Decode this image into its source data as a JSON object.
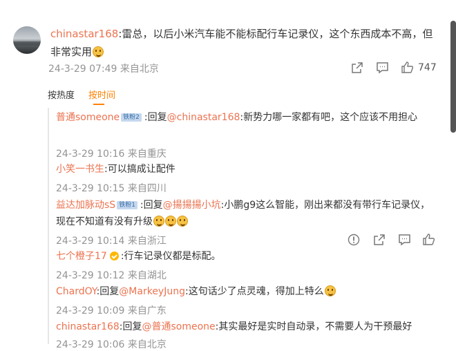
{
  "comment": {
    "author": "chinastar168",
    "text": ":雷总，以后小米汽车能不能标配行车记录仪，这个东西成本不高，但非常实用",
    "time_loc": "24-3-29 07:49 来自北京",
    "like_count": "747"
  },
  "sort": {
    "by_hot": "按热度",
    "by_time": "按时间"
  },
  "replies": [
    {
      "author": "普通someone",
      "badge": "铁粉2",
      "reply_word": ":回复",
      "mention": "@chinastar168",
      "text": ":新势力哪一家都有吧，这个应该不用担心",
      "time_loc": "24-3-29 10:16 来自重庆"
    },
    {
      "author": "小笑一书生",
      "text": ":可以搞成让配件",
      "time_loc": "24-3-29 10:15 来自四川"
    },
    {
      "author": "益达加脉动sS",
      "badge": "铁粉1",
      "reply_word": ":回复",
      "mention": "@揚揚揚小坑",
      "text": ":小鹏g9这么智能，刚出来都没有带行车记录仪，现在不知道有没有升级",
      "time_loc": "24-3-29 10:14 来自浙江"
    },
    {
      "author": "七个橙子17",
      "text": ":行车记录仪都是标配。",
      "time_loc": "24-3-29 10:12 来自湖北"
    },
    {
      "author": "ChardOY",
      "reply_word": ":回复",
      "mention": "@MarkeyJung",
      "text": ":这句话少了点灵魂，得加上特么",
      "time_loc": "24-3-29 10:09 来自广东"
    },
    {
      "author": "chinastar168",
      "reply_word": ":回复",
      "mention": "@普通someone",
      "text": ":其实最好是实时自动录，不需要人为干预最好",
      "time_loc": "24-3-29 10:06 来自北京"
    }
  ],
  "icons": [
    "share-icon",
    "comment-icon",
    "like-icon",
    "report-icon"
  ],
  "colors": {
    "name": "#eb7350",
    "accent": "#ff8200",
    "meta": "#939393"
  }
}
